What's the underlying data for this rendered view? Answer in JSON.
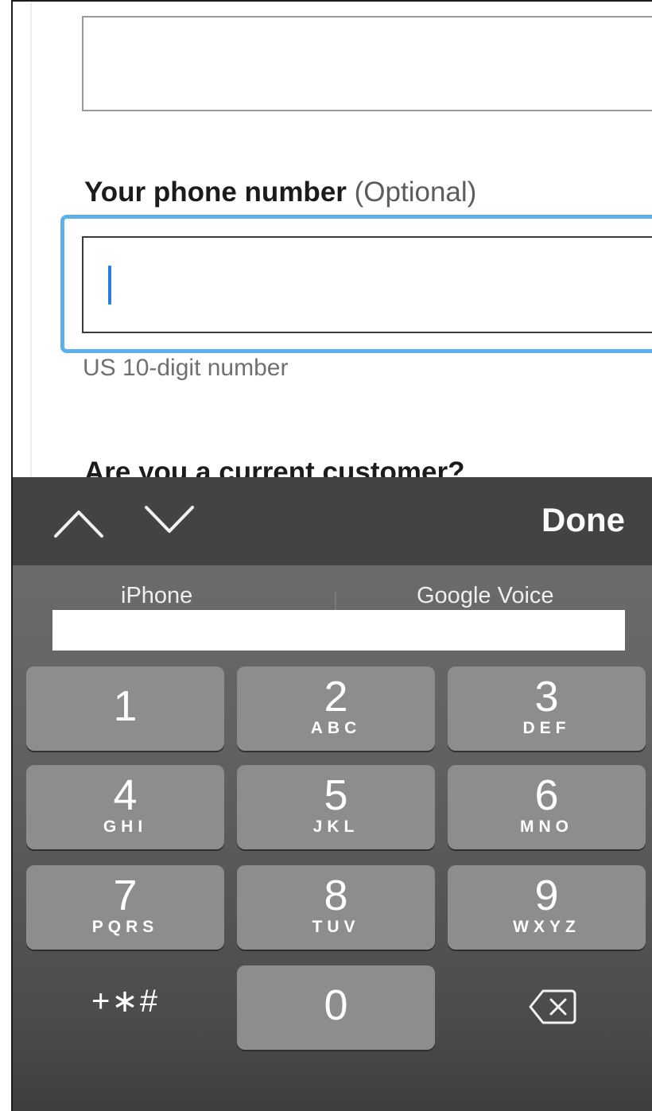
{
  "form": {
    "phone_label_required": "Your phone number",
    "phone_label_optional": "(Optional)",
    "phone_value": "",
    "phone_hint": "US 10-digit number",
    "next_question": "Are you a current customer?"
  },
  "accessory_bar": {
    "prev_icon": "chevron-up-icon",
    "next_icon": "chevron-down-icon",
    "done_label": "Done"
  },
  "keyboard": {
    "suggestions": [
      "iPhone",
      "Google Voice"
    ],
    "keys": [
      {
        "digit": "1",
        "letters": ""
      },
      {
        "digit": "2",
        "letters": "ABC"
      },
      {
        "digit": "3",
        "letters": "DEF"
      },
      {
        "digit": "4",
        "letters": "GHI"
      },
      {
        "digit": "5",
        "letters": "JKL"
      },
      {
        "digit": "6",
        "letters": "MNO"
      },
      {
        "digit": "7",
        "letters": "PQRS"
      },
      {
        "digit": "8",
        "letters": "TUV"
      },
      {
        "digit": "9",
        "letters": "WXYZ"
      },
      {
        "digit": "0",
        "letters": ""
      }
    ],
    "symbols_label": "+∗#",
    "delete_icon": "backspace-icon"
  },
  "colors": {
    "focus_ring": "#5cb1e8",
    "caret": "#2c7ce5",
    "accessory_bg": "#434343",
    "key_bg": "#8d8d8d"
  }
}
